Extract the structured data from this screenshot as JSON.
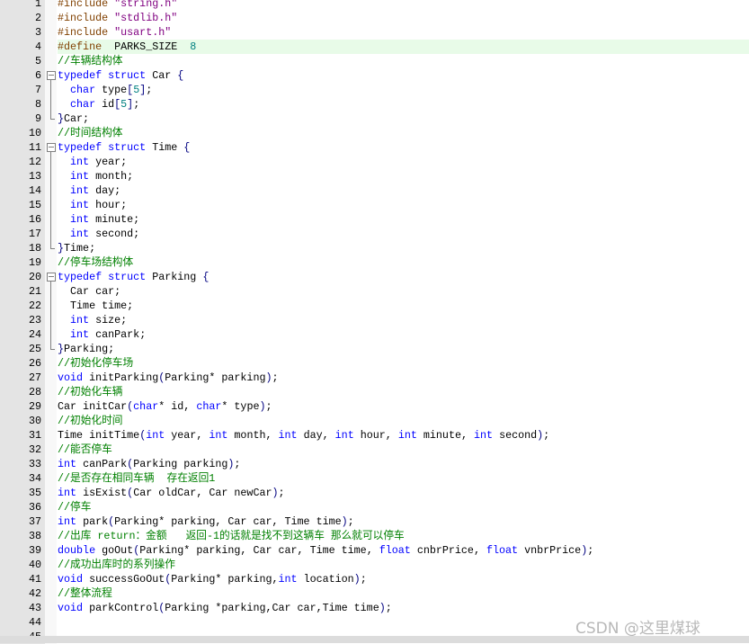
{
  "colors": {
    "preprocessor": "#804000",
    "string": "#800080",
    "number": "#008080",
    "keyword": "#0000ff",
    "comment": "#008000",
    "highlight_line": "#e8fbe8"
  },
  "editor": {
    "highlighted_line": 4,
    "fold_regions": [
      [
        6,
        9
      ],
      [
        11,
        18
      ],
      [
        20,
        25
      ]
    ],
    "lines": [
      [
        [
          "pp",
          "#include "
        ],
        [
          "str",
          "\"string.h\""
        ]
      ],
      [
        [
          "pp",
          "#include "
        ],
        [
          "str",
          "\"stdlib.h\""
        ]
      ],
      [
        [
          "pp",
          "#include "
        ],
        [
          "str",
          "\"usart.h\""
        ]
      ],
      [
        [
          "pp",
          "#define  "
        ],
        [
          "pl",
          "PARKS_SIZE  "
        ],
        [
          "num",
          "8"
        ]
      ],
      [
        [
          "cm",
          "//车辆结构体"
        ]
      ],
      [
        [
          "kw",
          "typedef struct "
        ],
        [
          "pl",
          "Car "
        ],
        [
          "pu",
          "{"
        ]
      ],
      [
        [
          "pl",
          "  "
        ],
        [
          "kw",
          "char "
        ],
        [
          "pl",
          "type"
        ],
        [
          "pu",
          "["
        ],
        [
          "num",
          "5"
        ],
        [
          "pu",
          "]"
        ],
        [
          "pl",
          ";"
        ]
      ],
      [
        [
          "pl",
          "  "
        ],
        [
          "kw",
          "char "
        ],
        [
          "pl",
          "id"
        ],
        [
          "pu",
          "["
        ],
        [
          "num",
          "5"
        ],
        [
          "pu",
          "]"
        ],
        [
          "pl",
          ";"
        ]
      ],
      [
        [
          "pu",
          "}"
        ],
        [
          "pl",
          "Car;"
        ]
      ],
      [
        [
          "cm",
          "//时间结构体"
        ]
      ],
      [
        [
          "kw",
          "typedef struct "
        ],
        [
          "pl",
          "Time "
        ],
        [
          "pu",
          "{"
        ]
      ],
      [
        [
          "pl",
          "  "
        ],
        [
          "kw",
          "int "
        ],
        [
          "pl",
          "year;"
        ]
      ],
      [
        [
          "pl",
          "  "
        ],
        [
          "kw",
          "int "
        ],
        [
          "pl",
          "month;"
        ]
      ],
      [
        [
          "pl",
          "  "
        ],
        [
          "kw",
          "int "
        ],
        [
          "pl",
          "day;"
        ]
      ],
      [
        [
          "pl",
          "  "
        ],
        [
          "kw",
          "int "
        ],
        [
          "pl",
          "hour;"
        ]
      ],
      [
        [
          "pl",
          "  "
        ],
        [
          "kw",
          "int "
        ],
        [
          "pl",
          "minute;"
        ]
      ],
      [
        [
          "pl",
          "  "
        ],
        [
          "kw",
          "int "
        ],
        [
          "pl",
          "second;"
        ]
      ],
      [
        [
          "pu",
          "}"
        ],
        [
          "pl",
          "Time;"
        ]
      ],
      [
        [
          "cm",
          "//停车场结构体"
        ]
      ],
      [
        [
          "kw",
          "typedef struct "
        ],
        [
          "pl",
          "Parking "
        ],
        [
          "pu",
          "{"
        ]
      ],
      [
        [
          "pl",
          "  Car car;"
        ]
      ],
      [
        [
          "pl",
          "  Time time;"
        ]
      ],
      [
        [
          "pl",
          "  "
        ],
        [
          "kw",
          "int "
        ],
        [
          "pl",
          "size;"
        ]
      ],
      [
        [
          "pl",
          "  "
        ],
        [
          "kw",
          "int "
        ],
        [
          "pl",
          "canPark;"
        ]
      ],
      [
        [
          "pu",
          "}"
        ],
        [
          "pl",
          "Parking;"
        ]
      ],
      [
        [
          "cm",
          "//初始化停车场"
        ]
      ],
      [
        [
          "kw",
          "void "
        ],
        [
          "pl",
          "initParking"
        ],
        [
          "pu",
          "("
        ],
        [
          "pl",
          "Parking* parking"
        ],
        [
          "pu",
          ")"
        ],
        [
          "pl",
          ";"
        ]
      ],
      [
        [
          "cm",
          "//初始化车辆"
        ]
      ],
      [
        [
          "pl",
          "Car initCar"
        ],
        [
          "pu",
          "("
        ],
        [
          "kw",
          "char"
        ],
        [
          "pl",
          "* id, "
        ],
        [
          "kw",
          "char"
        ],
        [
          "pl",
          "* type"
        ],
        [
          "pu",
          ")"
        ],
        [
          "pl",
          ";"
        ]
      ],
      [
        [
          "cm",
          "//初始化时间"
        ]
      ],
      [
        [
          "pl",
          "Time initTime"
        ],
        [
          "pu",
          "("
        ],
        [
          "kw",
          "int "
        ],
        [
          "pl",
          "year, "
        ],
        [
          "kw",
          "int "
        ],
        [
          "pl",
          "month, "
        ],
        [
          "kw",
          "int "
        ],
        [
          "pl",
          "day, "
        ],
        [
          "kw",
          "int "
        ],
        [
          "pl",
          "hour, "
        ],
        [
          "kw",
          "int "
        ],
        [
          "pl",
          "minute, "
        ],
        [
          "kw",
          "int "
        ],
        [
          "pl",
          "second"
        ],
        [
          "pu",
          ")"
        ],
        [
          "pl",
          ";"
        ]
      ],
      [
        [
          "cm",
          "//能否停车"
        ]
      ],
      [
        [
          "kw",
          "int "
        ],
        [
          "pl",
          "canPark"
        ],
        [
          "pu",
          "("
        ],
        [
          "pl",
          "Parking parking"
        ],
        [
          "pu",
          ")"
        ],
        [
          "pl",
          ";"
        ]
      ],
      [
        [
          "cm",
          "//是否存在相同车辆  存在返回1"
        ]
      ],
      [
        [
          "kw",
          "int "
        ],
        [
          "pl",
          "isExist"
        ],
        [
          "pu",
          "("
        ],
        [
          "pl",
          "Car oldCar, Car newCar"
        ],
        [
          "pu",
          ")"
        ],
        [
          "pl",
          ";"
        ]
      ],
      [
        [
          "cm",
          "//停车"
        ]
      ],
      [
        [
          "kw",
          "int "
        ],
        [
          "pl",
          "park"
        ],
        [
          "pu",
          "("
        ],
        [
          "pl",
          "Parking* parking, Car car, Time time"
        ],
        [
          "pu",
          ")"
        ],
        [
          "pl",
          ";"
        ]
      ],
      [
        [
          "cm",
          "//出库 return：金额   返回-1的话就是找不到这辆车 那么就可以停车"
        ]
      ],
      [
        [
          "kw",
          "double "
        ],
        [
          "pl",
          "goOut"
        ],
        [
          "pu",
          "("
        ],
        [
          "pl",
          "Parking* parking, Car car, Time time, "
        ],
        [
          "kw",
          "float "
        ],
        [
          "pl",
          "cnbrPrice, "
        ],
        [
          "kw",
          "float "
        ],
        [
          "pl",
          "vnbrPrice"
        ],
        [
          "pu",
          ")"
        ],
        [
          "pl",
          ";"
        ]
      ],
      [
        [
          "cm",
          "//成功出库时的系列操作"
        ]
      ],
      [
        [
          "kw",
          "void "
        ],
        [
          "pl",
          "successGoOut"
        ],
        [
          "pu",
          "("
        ],
        [
          "pl",
          "Parking* parking,"
        ],
        [
          "kw",
          "int "
        ],
        [
          "pl",
          "location"
        ],
        [
          "pu",
          ")"
        ],
        [
          "pl",
          ";"
        ]
      ],
      [
        [
          "cm",
          "//整体流程"
        ]
      ],
      [
        [
          "kw",
          "void "
        ],
        [
          "pl",
          "parkControl"
        ],
        [
          "pu",
          "("
        ],
        [
          "pl",
          "Parking *parking,Car car,Time time"
        ],
        [
          "pu",
          ")"
        ],
        [
          "pl",
          ";"
        ]
      ],
      [],
      []
    ]
  },
  "watermark": "CSDN @这里煤球"
}
